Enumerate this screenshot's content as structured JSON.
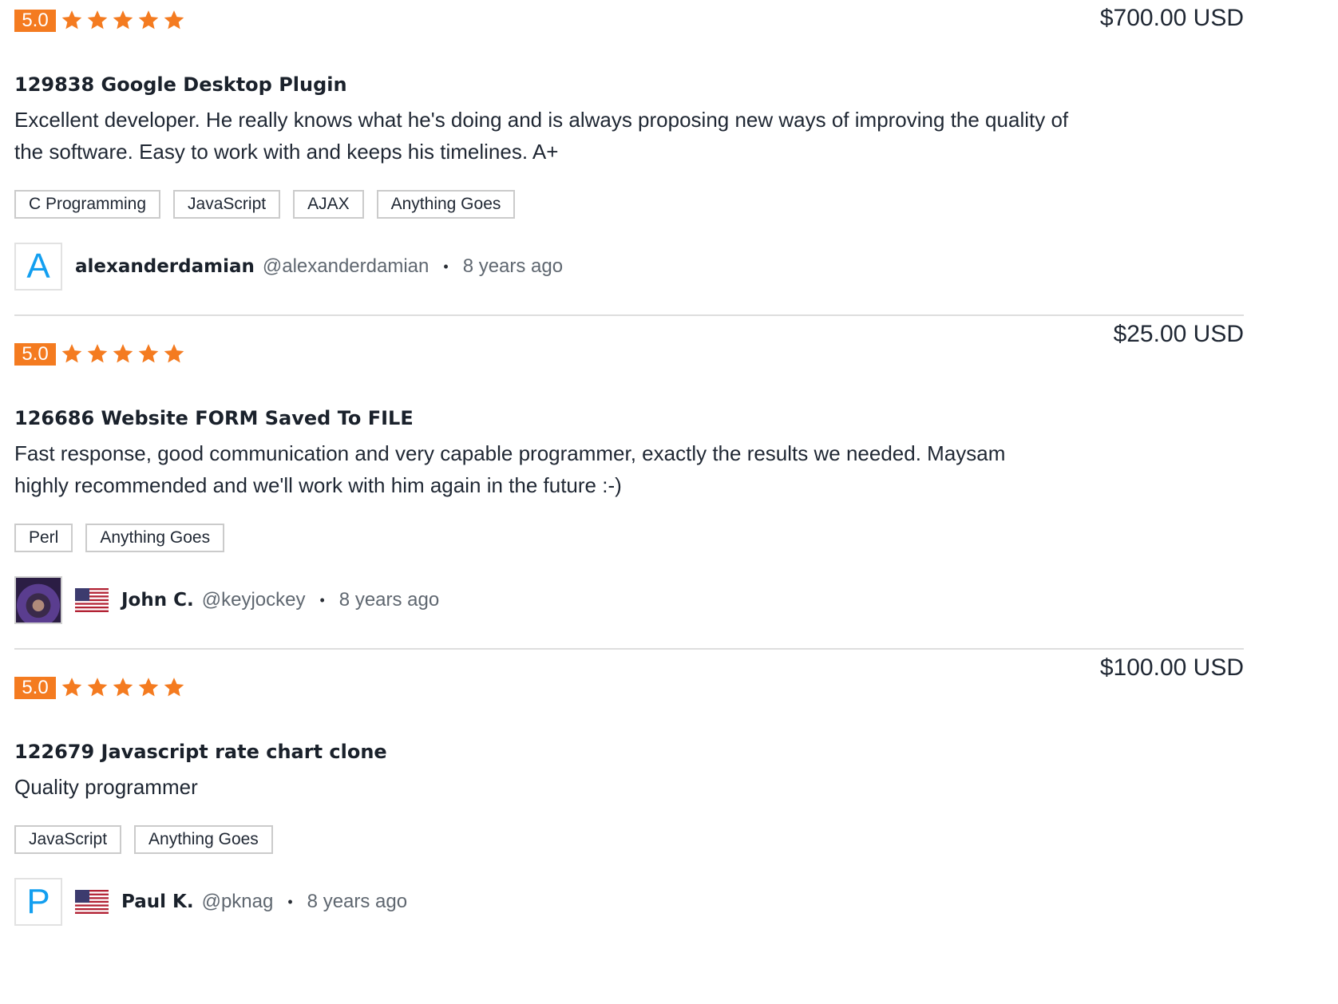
{
  "reviews": [
    {
      "rating": "5.0",
      "stars": 5,
      "price": "$700.00 USD",
      "title": "129838 Google Desktop Plugin",
      "comment": "Excellent developer. He really knows what he's doing and is always proposing new ways of improving the quality of the software. Easy to work with and keeps his timelines. A+",
      "tags": [
        "C Programming",
        "JavaScript",
        "AJAX",
        "Anything Goes"
      ],
      "avatar_letter": "A",
      "flag": null,
      "name": "alexanderdamian",
      "handle": "@alexanderdamian",
      "time": "8 years ago"
    },
    {
      "rating": "5.0",
      "stars": 5,
      "price": "$25.00 USD",
      "title": "126686 Website FORM Saved To FILE",
      "comment": "Fast response, good communication and very capable programmer, exactly the results we needed. Maysam highly recommended and we'll work with him again in the future :-)",
      "tags": [
        "Perl",
        "Anything Goes"
      ],
      "avatar_letter": "",
      "flag": "us-flag-icon",
      "name": "John C.",
      "handle": "@keyjockey",
      "time": "8 years ago"
    },
    {
      "rating": "5.0",
      "stars": 5,
      "price": "$100.00 USD",
      "title": "122679 Javascript rate chart clone",
      "comment": "Quality programmer",
      "tags": [
        "JavaScript",
        "Anything Goes"
      ],
      "avatar_letter": "P",
      "flag": "us-flag-icon",
      "name": "Paul K.",
      "handle": "@pknag",
      "time": "8 years ago"
    }
  ],
  "separator": "•",
  "colors": {
    "accent": "#f47b20",
    "avatar_letter": "#139ff0"
  }
}
